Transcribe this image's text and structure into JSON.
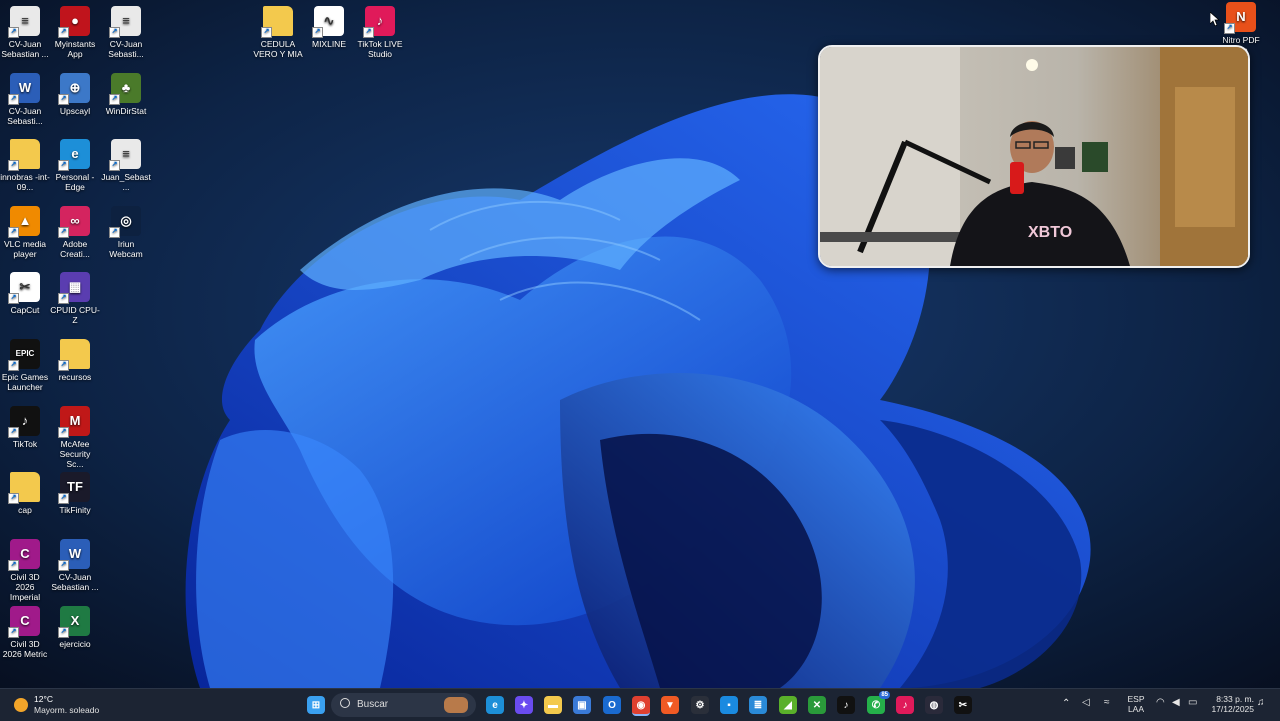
{
  "desktop": {
    "icons": [
      {
        "label": "CV-Juan Sebastian ...",
        "icon": "pdf-document-icon",
        "color": "#e9e9e9",
        "glyph": "≡"
      },
      {
        "label": "Myinstants App",
        "icon": "myinstants-icon",
        "color": "#c0141c",
        "glyph": "●"
      },
      {
        "label": "CV-Juan Sebasti...",
        "icon": "pdf-document-icon",
        "color": "#e9e9e9",
        "glyph": "≡"
      },
      {
        "label": "CV-Juan Sebasti...",
        "icon": "word-document-icon",
        "color": "#2b5eb8",
        "glyph": "W"
      },
      {
        "label": "Upscayl",
        "icon": "upscayl-icon",
        "color": "#3c78c8",
        "glyph": "⊕"
      },
      {
        "label": "WinDirStat",
        "icon": "windirstat-icon",
        "color": "#4a7a2a",
        "glyph": "♣"
      },
      {
        "label": "innobras -int- 09...",
        "icon": "folder-icon",
        "color": "#f3c94d",
        "glyph": ""
      },
      {
        "label": "Personal - Edge",
        "icon": "edge-icon",
        "color": "#1d8fd8",
        "glyph": "e"
      },
      {
        "label": "Juan_Sebast...",
        "icon": "pdf-document-icon",
        "color": "#e9e9e9",
        "glyph": "≡"
      },
      {
        "label": "VLC media player",
        "icon": "vlc-icon",
        "color": "#f08a00",
        "glyph": "▲"
      },
      {
        "label": "Adobe Creati...",
        "icon": "adobe-cc-icon",
        "color": "#d4245f",
        "glyph": "∞"
      },
      {
        "label": "Iriun Webcam",
        "icon": "iriun-webcam-icon",
        "color": "#0d2140",
        "glyph": "◎"
      },
      {
        "label": "CapCut",
        "icon": "capcut-icon",
        "color": "#ffffff",
        "glyph": "✂"
      },
      {
        "label": "CPUID CPU-Z",
        "icon": "cpuz-icon",
        "color": "#5a3db0",
        "glyph": "▦"
      },
      {
        "label": "Epic Games Launcher",
        "icon": "epic-games-icon",
        "color": "#111111",
        "glyph": "EPIC"
      },
      {
        "label": "recursos",
        "icon": "folder-icon",
        "color": "#f3c94d",
        "glyph": ""
      },
      {
        "label": "TikTok",
        "icon": "tiktok-icon",
        "color": "#111111",
        "glyph": "♪"
      },
      {
        "label": "McAfee Security Sc...",
        "icon": "mcafee-icon",
        "color": "#c01818",
        "glyph": "M"
      },
      {
        "label": "cap",
        "icon": "folder-icon",
        "color": "#f3c94d",
        "glyph": ""
      },
      {
        "label": "TikFinity",
        "icon": "tikfinity-icon",
        "color": "#1a1a2a",
        "glyph": "TF"
      },
      {
        "label": "Civil 3D 2026 Imperial",
        "icon": "civil3d-icon",
        "color": "#a01a8a",
        "glyph": "C"
      },
      {
        "label": "CV-Juan Sebastian ...",
        "icon": "word-document-icon",
        "color": "#2b5eb8",
        "glyph": "W"
      },
      {
        "label": "Civil 3D 2026 Metric",
        "icon": "civil3d-icon",
        "color": "#a01a8a",
        "glyph": "C"
      },
      {
        "label": "ejercicio",
        "icon": "excel-document-icon",
        "color": "#1f7a43",
        "glyph": "X"
      },
      {
        "label": "CEDULA VERO Y MIA",
        "icon": "folder-icon",
        "color": "#f3c94d",
        "glyph": ""
      },
      {
        "label": "MIXLINE",
        "icon": "mixline-icon",
        "color": "#ffffff",
        "glyph": "∿"
      },
      {
        "label": "TikTok LIVE Studio",
        "icon": "tiktok-live-studio-icon",
        "color": "#e01a5a",
        "glyph": "♪"
      },
      {
        "label": "Nitro PDF Pro",
        "icon": "nitro-pdf-icon",
        "color": "#e8501a",
        "glyph": "N"
      }
    ]
  },
  "taskbar": {
    "weather": {
      "temp": "12°C",
      "desc": "Mayorm. soleado",
      "icon": "sun-icon"
    },
    "search_placeholder": "Buscar",
    "pinned": [
      {
        "icon": "windows-start-icon",
        "color": "#3aa0f0",
        "glyph": "⊞"
      },
      {
        "icon": "edge-icon",
        "color": "#1d8fd8",
        "glyph": "e"
      },
      {
        "icon": "copilot-icon",
        "color": "#6a4cf0",
        "glyph": "✦"
      },
      {
        "icon": "file-explorer-icon",
        "color": "#f3c94d",
        "glyph": "▬"
      },
      {
        "icon": "microsoft-store-icon",
        "color": "#3a7ad8",
        "glyph": "▣"
      },
      {
        "icon": "outlook-icon",
        "color": "#1a6ad0",
        "glyph": "O"
      },
      {
        "icon": "chrome-icon",
        "color": "#e04030",
        "glyph": "◉"
      },
      {
        "icon": "brave-icon",
        "color": "#f05a24",
        "glyph": "▼"
      },
      {
        "icon": "chatgpt-icon",
        "color": "#2a2f3a",
        "glyph": "⚙"
      },
      {
        "icon": "blue-app-icon",
        "color": "#1a8ae0",
        "glyph": "▪"
      },
      {
        "icon": "notepad-icon",
        "color": "#2a8ad8",
        "glyph": "≣"
      },
      {
        "icon": "nvidia-icon",
        "color": "#5ab02a",
        "glyph": "◢"
      },
      {
        "icon": "xbox-icon",
        "color": "#2a9a3a",
        "glyph": "✕"
      },
      {
        "icon": "tiktok-icon",
        "color": "#111111",
        "glyph": "♪"
      },
      {
        "icon": "whatsapp-icon",
        "color": "#25b04a",
        "glyph": "✆"
      },
      {
        "icon": "tiktok-live-studio-icon",
        "color": "#e01a5a",
        "glyph": "♪"
      },
      {
        "icon": "obs-icon",
        "color": "#2a2a3a",
        "glyph": "◍"
      },
      {
        "icon": "capcut-icon",
        "color": "#111111",
        "glyph": "✂"
      }
    ],
    "whatsapp_badge": "85",
    "language": {
      "line1": "ESP",
      "line2": "LAA"
    },
    "clock": {
      "time": "8:33 p. m.",
      "date": "17/12/2025"
    }
  }
}
